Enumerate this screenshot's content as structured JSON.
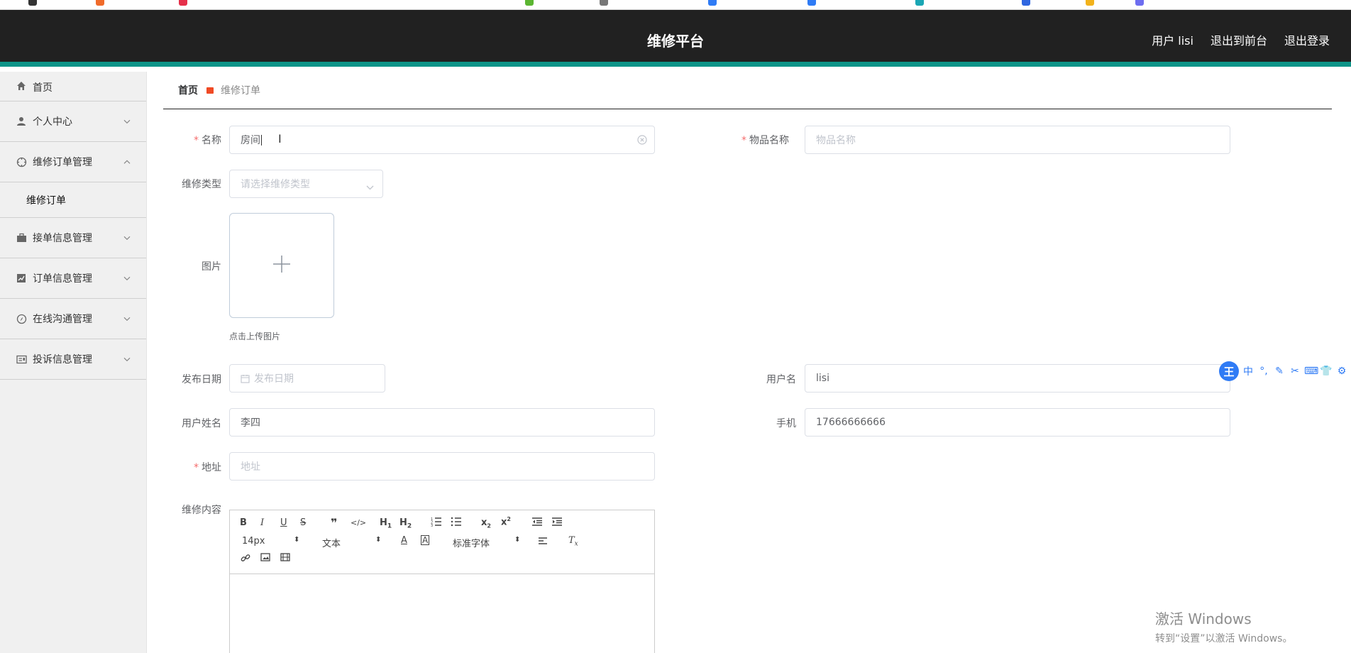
{
  "header": {
    "title": "维修平台",
    "user_label": "用户 lisi",
    "exit_front_label": "退出到前台",
    "logout_label": "退出登录"
  },
  "sidebar": {
    "items": [
      {
        "label": "首页"
      },
      {
        "label": "个人中心"
      },
      {
        "label": "维修订单管理"
      },
      {
        "label": "接单信息管理"
      },
      {
        "label": "订单信息管理"
      },
      {
        "label": "在线沟通管理"
      },
      {
        "label": "投诉信息管理"
      }
    ],
    "submenu": [
      "维修订单"
    ]
  },
  "breadcrumb": {
    "home": "首页",
    "current": "维修订单"
  },
  "form": {
    "name": {
      "label": "名称",
      "value": "房间"
    },
    "item_name": {
      "label": "物品名称",
      "placeholder": "物品名称"
    },
    "repair_type": {
      "label": "维修类型",
      "placeholder": "请选择维修类型"
    },
    "image": {
      "label": "图片",
      "tip": "点击上传图片"
    },
    "publish_date": {
      "label": "发布日期",
      "placeholder": "发布日期"
    },
    "username": {
      "label": "用户名",
      "value": "lisi"
    },
    "user_fullname": {
      "label": "用户姓名",
      "value": "李四"
    },
    "phone": {
      "label": "手机",
      "value": "17666666666"
    },
    "address": {
      "label": "地址",
      "placeholder": "地址"
    },
    "content": {
      "label": "维修内容"
    }
  },
  "editor_toolbar": {
    "font_size": "14px",
    "block_type": "文本",
    "font_family": "标准字体"
  },
  "ime": {
    "mode": "中"
  },
  "watermark": {
    "line1": "激活 Windows",
    "line2": "转到“设置”以激活 Windows。"
  },
  "colors": {
    "header_bg": "#212121",
    "accent": "#0e9488",
    "required": "#f56c6c"
  }
}
